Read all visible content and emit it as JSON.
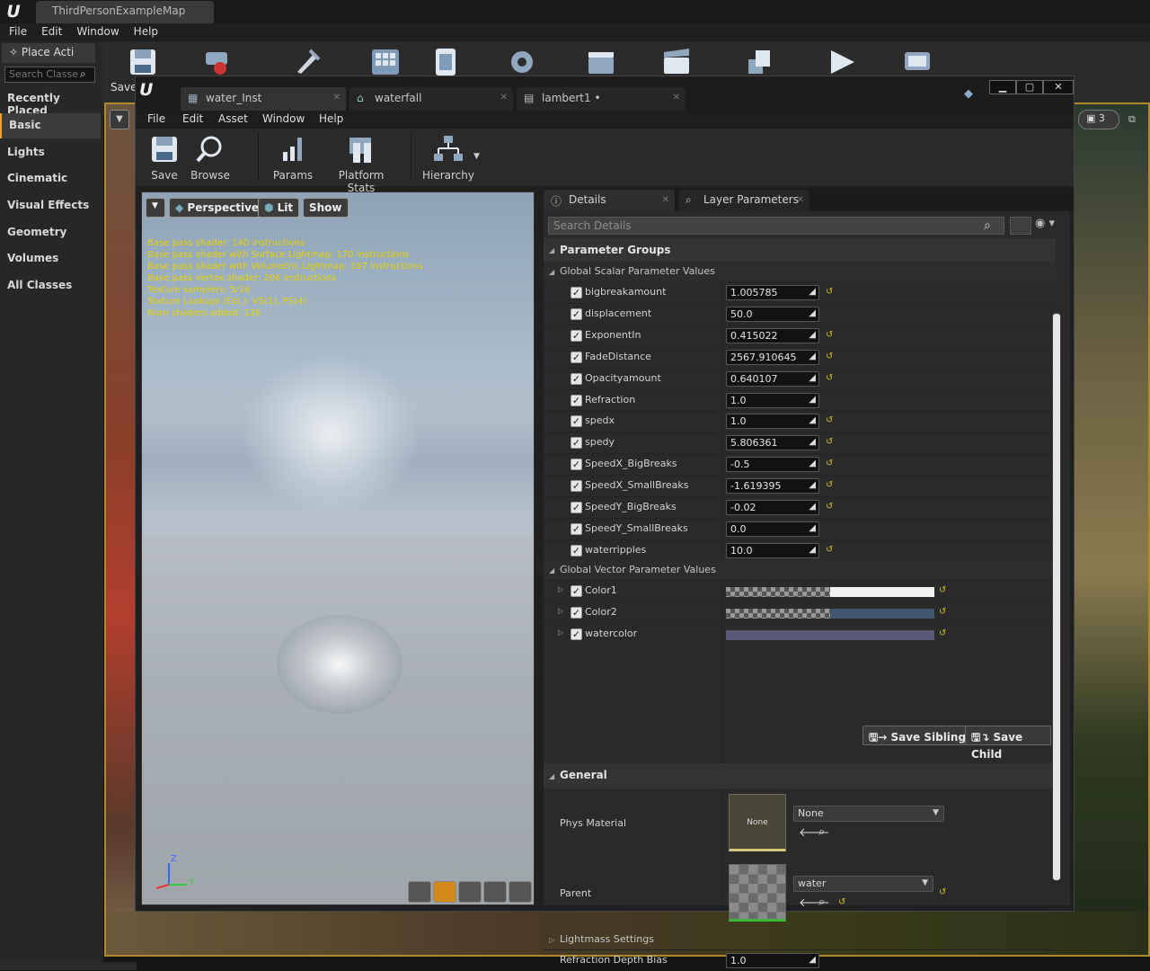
{
  "outer": {
    "tab_title": "ThirdPersonExampleMap",
    "menu": [
      "File",
      "Edit",
      "Window",
      "Help"
    ],
    "toolbar_save": "Save",
    "place_tab": "Place Acti",
    "search_placeholder": "Search Classe",
    "categories": [
      "Recently Placed",
      "Basic",
      "Lights",
      "Cinematic",
      "Visual Effects",
      "Geometry",
      "Volumes",
      "All Classes"
    ],
    "right_badge": "3"
  },
  "editor": {
    "tabs": [
      "water_Inst",
      "waterfall",
      "lambert1 •"
    ],
    "menu": [
      "File",
      "Edit",
      "Asset",
      "Window",
      "Help"
    ],
    "toolbar": {
      "save": "Save",
      "browse": "Browse",
      "params": "Params",
      "platform_stats": "Platform Stats",
      "hierarchy": "Hierarchy"
    }
  },
  "viewport": {
    "perspective": "Perspective",
    "lit": "Lit",
    "show": "Show",
    "stats": [
      "Base pass shader: 140 instructions",
      "Base pass shader with Surface Lightmap: 170 instructions",
      "Base pass shader with Volumetric Lightmap: 167 instructions",
      "Base pass vertex shader: 206 instructions",
      "Texture samplers: 5/16",
      "Texture Lookups (Est.): VS(1), PS(4)",
      "Num shaders added: 126"
    ],
    "axis_z": "Z",
    "axis_y": "Y"
  },
  "details": {
    "tab_details": "Details",
    "tab_layer": "Layer Parameters",
    "search_placeholder": "Search Details",
    "parameter_groups": "Parameter Groups",
    "scalar_header": "Global Scalar Parameter Values",
    "scalars": [
      {
        "name": "bigbreakamount",
        "value": "1.005785",
        "reset": true
      },
      {
        "name": "displacement",
        "value": "50.0",
        "reset": false
      },
      {
        "name": "ExponentIn",
        "value": "0.415022",
        "reset": true
      },
      {
        "name": "FadeDistance",
        "value": "2567.910645",
        "reset": true
      },
      {
        "name": "Opacityamount",
        "value": "0.640107",
        "reset": true
      },
      {
        "name": "Refraction",
        "value": "1.0",
        "reset": false
      },
      {
        "name": "spedx",
        "value": "1.0",
        "reset": true
      },
      {
        "name": "spedy",
        "value": "5.806361",
        "reset": true
      },
      {
        "name": "SpeedX_BigBreaks",
        "value": "-0.5",
        "reset": true
      },
      {
        "name": "SpeedX_SmallBreaks",
        "value": "-1.619395",
        "reset": true
      },
      {
        "name": "SpeedY_BigBreaks",
        "value": "-0.02",
        "reset": true
      },
      {
        "name": "SpeedY_SmallBreaks",
        "value": "0.0",
        "reset": false
      },
      {
        "name": "waterripples",
        "value": "10.0",
        "reset": true
      }
    ],
    "vector_header": "Global Vector Parameter Values",
    "vectors": [
      {
        "name": "Color1",
        "color": "#f2f2f2"
      },
      {
        "name": "Color2",
        "color": "#3e5670"
      },
      {
        "name": "watercolor",
        "color": "#5a5a78"
      }
    ],
    "save_sibling": "Save Sibling",
    "save_child": "Save Child",
    "general": "General",
    "phys_material_label": "Phys Material",
    "phys_material_value": "None",
    "phys_thumb_text": "None",
    "parent_label": "Parent",
    "parent_value": "water",
    "lightmass": "Lightmass Settings",
    "refraction_bias_label": "Refraction Depth Bias",
    "refraction_bias_value": "1.0"
  }
}
